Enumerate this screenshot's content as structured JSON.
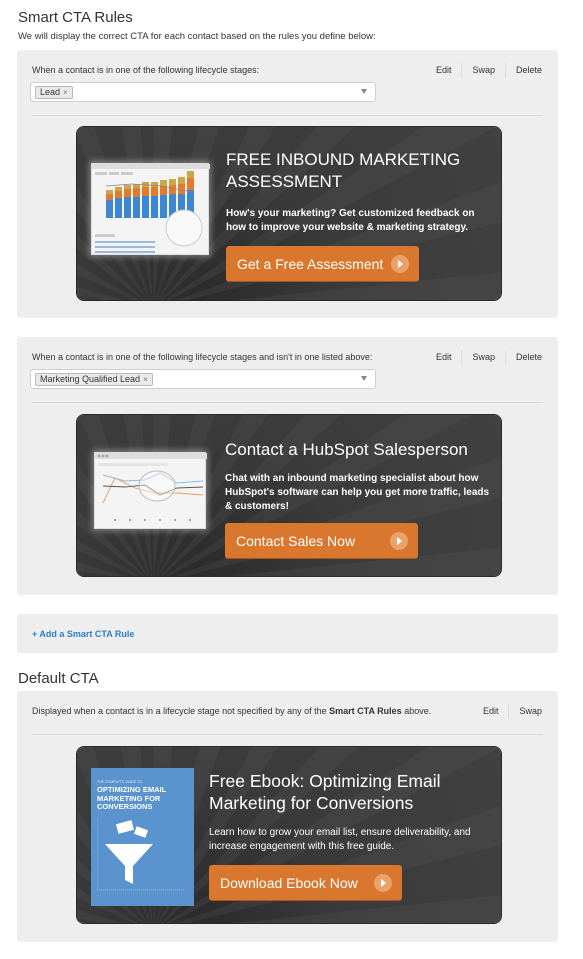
{
  "smart_rules": {
    "title": "Smart CTA Rules",
    "subtitle": "We will display the correct CTA for each contact based on the rules you define below:",
    "rules": [
      {
        "label": "When a contact is in one of the following lifecycle stages:",
        "actions": [
          "Edit",
          "Swap",
          "Delete"
        ],
        "selected_tag": "Lead",
        "tag_remove": "×",
        "cta": {
          "title": "FREE INBOUND MARKETING ASSESSMENT",
          "description": "How's your marketing? Get customized feedback on how to improve your website & marketing strategy.",
          "button": "Get a Free Assessment",
          "image": "analytics-dashboard-screenshot"
        }
      },
      {
        "label": "When a contact is in one of the following lifecycle stages and isn't in one listed above:",
        "actions": [
          "Edit",
          "Swap",
          "Delete"
        ],
        "selected_tag": "Marketing Qualified Lead",
        "tag_remove": "×",
        "cta": {
          "title": "Contact a HubSpot Salesperson",
          "description": "Chat with an inbound marketing specialist about how HubSpot's software can help you get more traffic, leads & customers!",
          "button": "Contact Sales Now",
          "image": "landing-page-analytics-screenshot"
        }
      }
    ],
    "add_rule": "+ Add a Smart CTA Rule"
  },
  "default_cta": {
    "title": "Default CTA",
    "label_pre": "Displayed when a contact is in a lifecycle stage not specified by any of the ",
    "label_bold": "Smart CTA Rules",
    "label_post": " above.",
    "actions": [
      "Edit",
      "Swap"
    ],
    "cta": {
      "title": "Free Ebook: Optimizing Email Marketing for Conversions",
      "description": "Learn how to grow your email list, ensure deliverability, and increase engagement with this free guide.",
      "button": "Download Ebook Now",
      "ebook_kicker": "THE COMPLETE GUIDE TO",
      "ebook_title": "OPTIMIZING EMAIL MARKETING FOR CONVERSIONS"
    }
  },
  "colors": {
    "accent_button": "#d9772f",
    "link": "#2e7fc6",
    "panel": "#eeeeee"
  }
}
